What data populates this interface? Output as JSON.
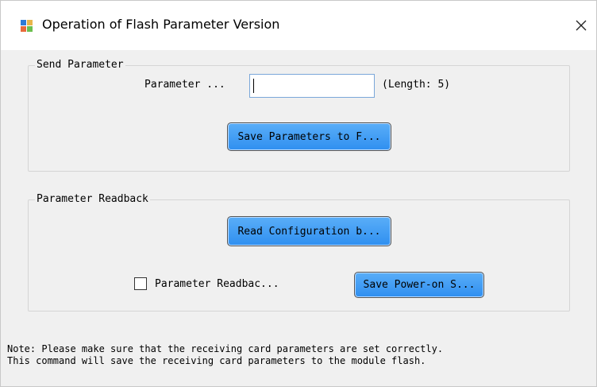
{
  "window": {
    "title": "Operation of Flash Parameter Version",
    "icon": "app-window-icon",
    "close_icon": "close-icon"
  },
  "send_group": {
    "legend": "Send Parameter",
    "parameter_label": "Parameter ...",
    "parameter_value": "",
    "length_label": "(Length: 5)",
    "save_button": "Save Parameters to F..."
  },
  "readback_group": {
    "legend": "Parameter Readback",
    "read_button": "Read Configuration b...",
    "checkbox_label": "Parameter Readbac...",
    "checkbox_checked": false,
    "save_power_button": "Save Power-on S..."
  },
  "note": {
    "line1": "Note: Please make sure that the receiving card parameters are set correctly.",
    "line2": "This command will save the receiving card parameters to the module flash."
  },
  "colors": {
    "button_top": "#5aaef8",
    "button_bottom": "#2f8ff0",
    "window_bg": "#f0f0f0",
    "input_border": "#7aa7d9"
  }
}
